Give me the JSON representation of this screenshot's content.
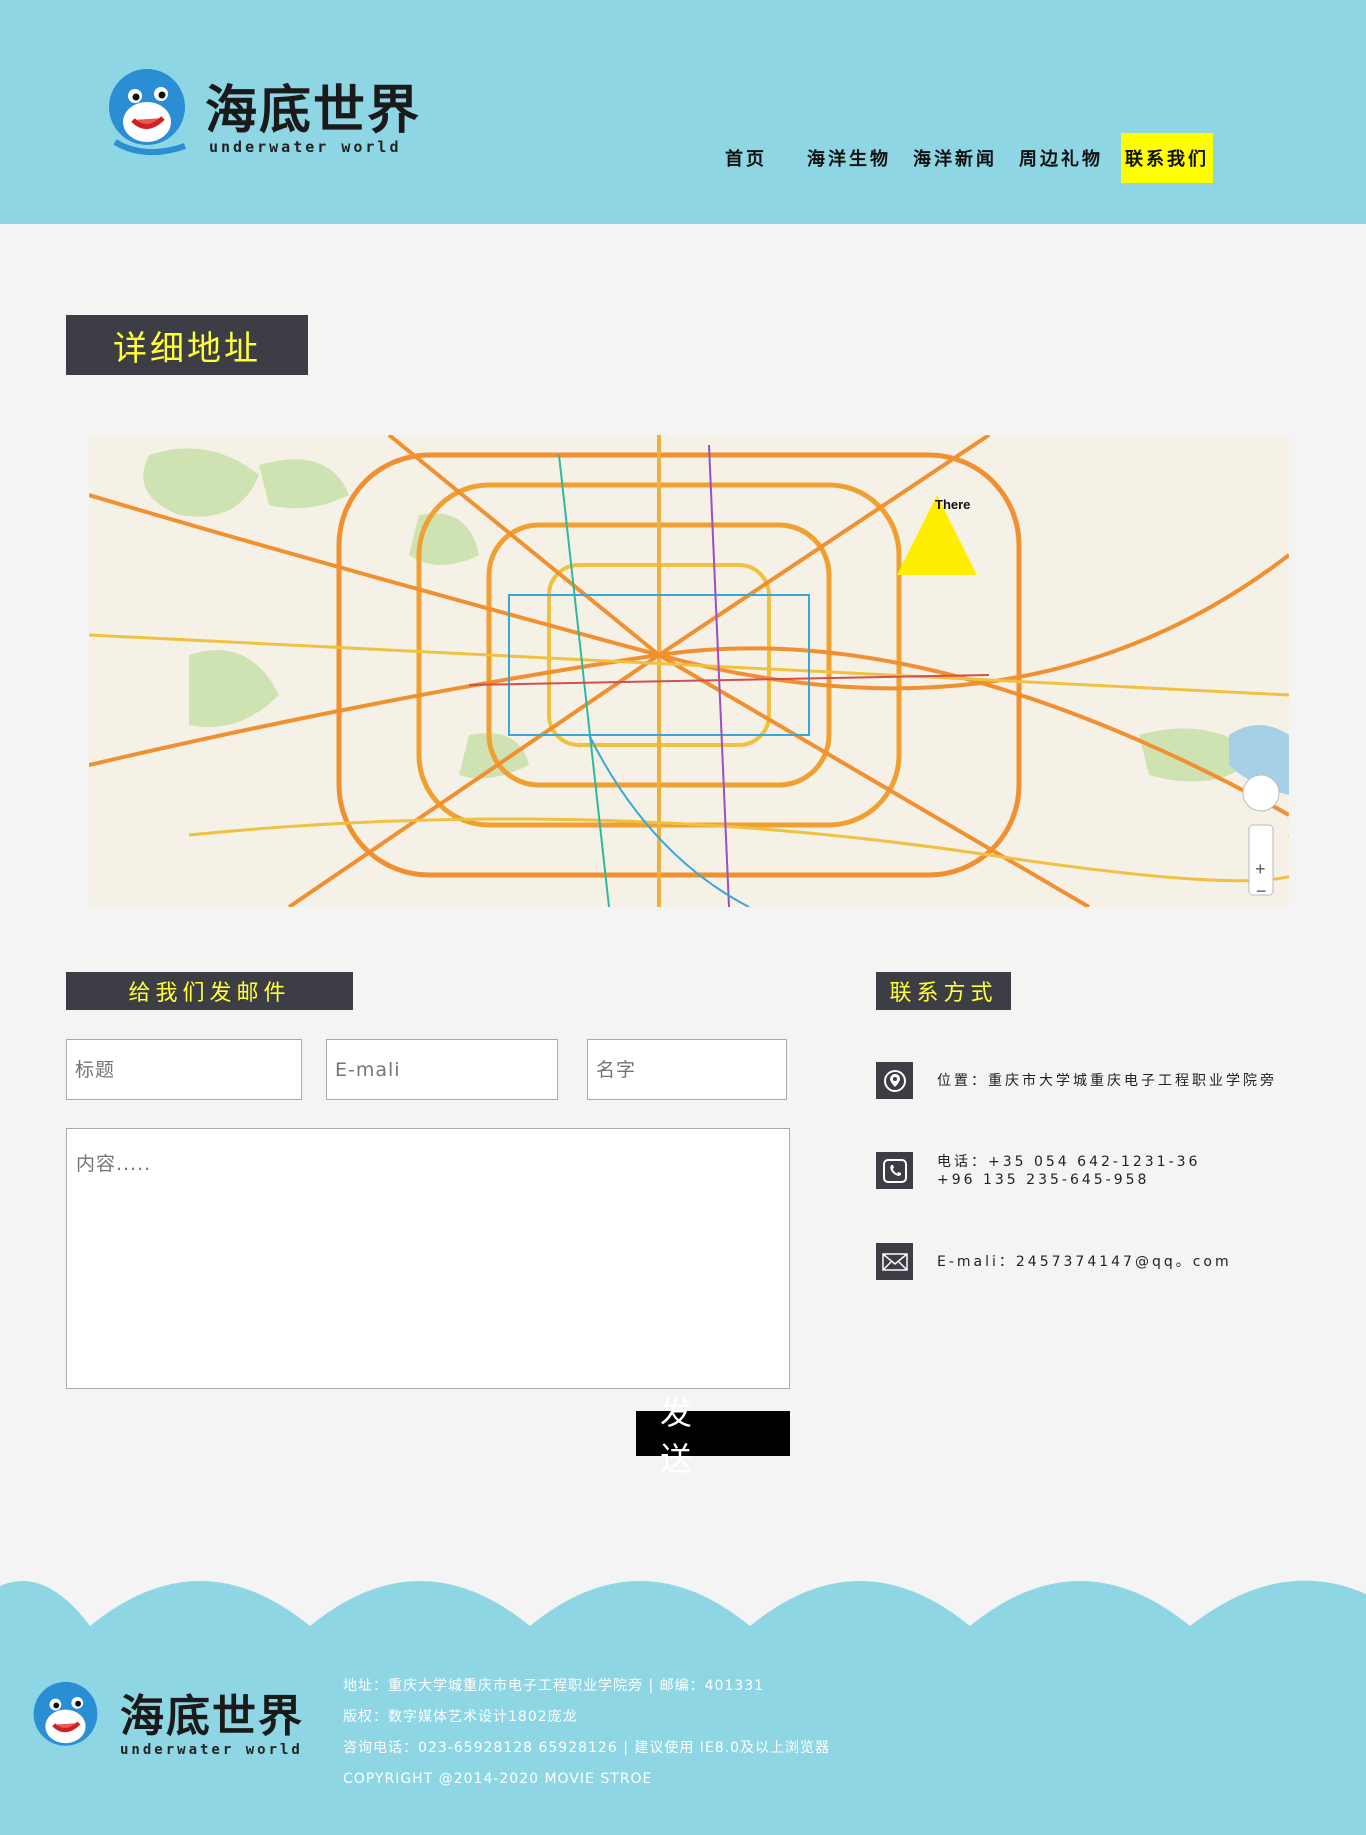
{
  "header": {
    "logo_title": "海底世界",
    "logo_subtitle": "underwater world",
    "nav": [
      "首页",
      "海洋生物",
      "海洋新闻",
      "周边礼物",
      "联系我们"
    ]
  },
  "address_section": {
    "title": "详细地址",
    "map_marker": "There"
  },
  "mail_section": {
    "title": "给我们发邮件",
    "title_placeholder": "标题",
    "email_placeholder": "E-mali",
    "name_placeholder": "名字",
    "content_placeholder": "内容.....",
    "send_label": "发 送"
  },
  "contact_section": {
    "title": "联系方式",
    "address": "位置：重庆市大学城重庆电子工程职业学院旁",
    "phone_line1": "电话：+35 054 642-1231-36",
    "phone_line2": "+96 135 235-645-958",
    "email": "E-mali：2457374147@qq。com"
  },
  "footer": {
    "logo_title": "海底世界",
    "logo_subtitle": "underwater world",
    "line1": "地址：重庆大学城重庆市电子工程职业学院旁 | 邮编：401331",
    "line2": "版权：数字媒体艺术设计1802庞龙",
    "line3": "咨询电话：023-65928128 65928126 | 建议使用 IE8.0及以上浏览器",
    "line4": "COPYRIGHT @2014-2020 MOVIE STROE"
  },
  "colors": {
    "header_bg": "#8ed6e4",
    "accent_yellow": "#ffff00",
    "title_block_bg": "#3d3d45"
  }
}
